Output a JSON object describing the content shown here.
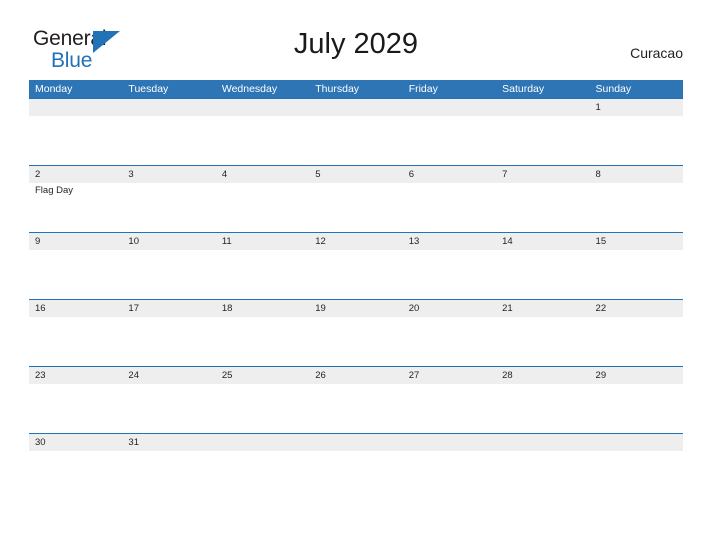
{
  "brand": {
    "name_part1": "General",
    "name_part2": "Blue",
    "logo_icon": "triangle-flag-icon"
  },
  "header": {
    "title": "July 2029",
    "location": "Curacao"
  },
  "calendar": {
    "month": "July",
    "year": "2029",
    "accent_color": "#2e75b6",
    "band_color": "#eeeeee",
    "weekday_headers": [
      "Monday",
      "Tuesday",
      "Wednesday",
      "Thursday",
      "Friday",
      "Saturday",
      "Sunday"
    ],
    "weeks": [
      [
        {
          "num": ""
        },
        {
          "num": ""
        },
        {
          "num": ""
        },
        {
          "num": ""
        },
        {
          "num": ""
        },
        {
          "num": ""
        },
        {
          "num": "1"
        }
      ],
      [
        {
          "num": "2",
          "event": "Flag Day"
        },
        {
          "num": "3"
        },
        {
          "num": "4"
        },
        {
          "num": "5"
        },
        {
          "num": "6"
        },
        {
          "num": "7"
        },
        {
          "num": "8"
        }
      ],
      [
        {
          "num": "9"
        },
        {
          "num": "10"
        },
        {
          "num": "11"
        },
        {
          "num": "12"
        },
        {
          "num": "13"
        },
        {
          "num": "14"
        },
        {
          "num": "15"
        }
      ],
      [
        {
          "num": "16"
        },
        {
          "num": "17"
        },
        {
          "num": "18"
        },
        {
          "num": "19"
        },
        {
          "num": "20"
        },
        {
          "num": "21"
        },
        {
          "num": "22"
        }
      ],
      [
        {
          "num": "23"
        },
        {
          "num": "24"
        },
        {
          "num": "25"
        },
        {
          "num": "26"
        },
        {
          "num": "27"
        },
        {
          "num": "28"
        },
        {
          "num": "29"
        }
      ],
      [
        {
          "num": "30"
        },
        {
          "num": "31"
        },
        {
          "num": ""
        },
        {
          "num": ""
        },
        {
          "num": ""
        },
        {
          "num": ""
        },
        {
          "num": ""
        }
      ]
    ]
  }
}
